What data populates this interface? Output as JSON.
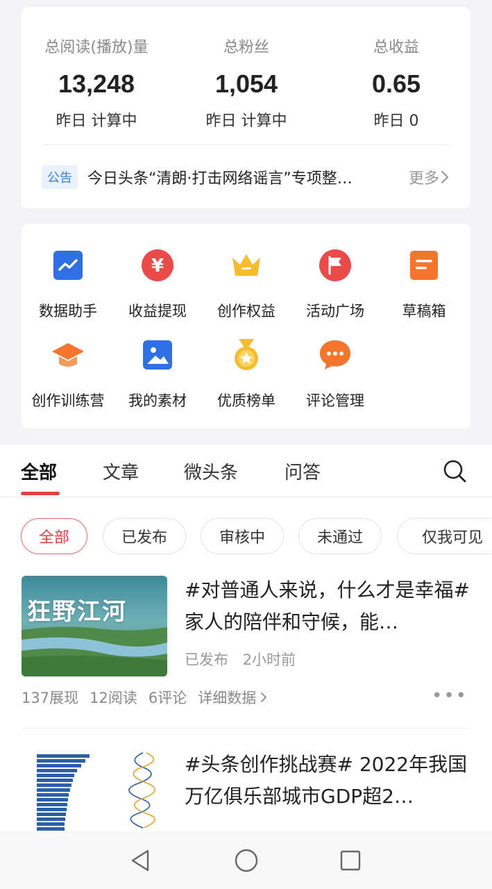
{
  "stats": {
    "items": [
      {
        "label": "总阅读(播放)量",
        "value": "13,248",
        "sub": "昨日 计算中"
      },
      {
        "label": "总粉丝",
        "value": "1,054",
        "sub": "昨日 计算中"
      },
      {
        "label": "总收益",
        "value": "0.65",
        "sub": "昨日 0"
      }
    ],
    "notice": {
      "tag": "公告",
      "text": "今日头条“清朗·打击网络谣言”专项整…",
      "more": "更多"
    }
  },
  "tools": [
    {
      "label": "数据助手",
      "icon": "chart-icon",
      "color": "#2f6fe4"
    },
    {
      "label": "收益提现",
      "icon": "yuan-coin-icon",
      "color": "#ea4a4a"
    },
    {
      "label": "创作权益",
      "icon": "crown-icon",
      "color": "#f5bd2e"
    },
    {
      "label": "活动广场",
      "icon": "flag-icon",
      "color": "#ea4a4a"
    },
    {
      "label": "草稿箱",
      "icon": "draft-box-icon",
      "color": "#f4762e"
    },
    {
      "label": "创作训练营",
      "icon": "graduation-cap-icon",
      "color": "#f4762e"
    },
    {
      "label": "我的素材",
      "icon": "image-icon",
      "color": "#2f6fe4"
    },
    {
      "label": "优质榜单",
      "icon": "medal-icon",
      "color": "#f5bd2e"
    },
    {
      "label": "评论管理",
      "icon": "comment-icon",
      "color": "#f4762e"
    }
  ],
  "tabs": [
    {
      "label": "全部",
      "active": true
    },
    {
      "label": "文章"
    },
    {
      "label": "微头条"
    },
    {
      "label": "问答"
    }
  ],
  "filters": [
    {
      "label": "全部",
      "active": true
    },
    {
      "label": "已发布"
    },
    {
      "label": "审核中"
    },
    {
      "label": "未通过"
    },
    {
      "label": "仅我可见"
    }
  ],
  "posts": [
    {
      "thumb_text": "狂野江河",
      "title": "#对普通人来说，什么才是幸福#家人的陪伴和守候，能…",
      "status": "已发布",
      "time": "2小时前",
      "impressions": "137展现",
      "reads": "12阅读",
      "comments": "6评论",
      "details": "详细数据"
    },
    {
      "title": "#头条创作挑战赛# 2022年我国万亿俱乐部城市GDP超2…"
    }
  ],
  "colors": {
    "accent": "#e04040",
    "blue": "#2f6fe4",
    "orange": "#f4762e",
    "yellow": "#f5bd2e"
  }
}
